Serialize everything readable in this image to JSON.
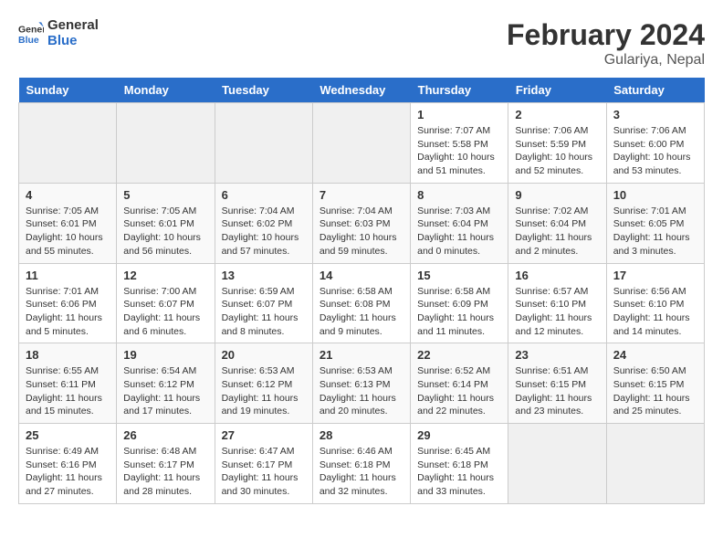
{
  "header": {
    "logo_line1": "General",
    "logo_line2": "Blue",
    "title": "February 2024",
    "subtitle": "Gulariya, Nepal"
  },
  "days_of_week": [
    "Sunday",
    "Monday",
    "Tuesday",
    "Wednesday",
    "Thursday",
    "Friday",
    "Saturday"
  ],
  "weeks": [
    [
      {
        "num": "",
        "info": ""
      },
      {
        "num": "",
        "info": ""
      },
      {
        "num": "",
        "info": ""
      },
      {
        "num": "",
        "info": ""
      },
      {
        "num": "1",
        "info": "Sunrise: 7:07 AM\nSunset: 5:58 PM\nDaylight: 10 hours and 51 minutes."
      },
      {
        "num": "2",
        "info": "Sunrise: 7:06 AM\nSunset: 5:59 PM\nDaylight: 10 hours and 52 minutes."
      },
      {
        "num": "3",
        "info": "Sunrise: 7:06 AM\nSunset: 6:00 PM\nDaylight: 10 hours and 53 minutes."
      }
    ],
    [
      {
        "num": "4",
        "info": "Sunrise: 7:05 AM\nSunset: 6:01 PM\nDaylight: 10 hours and 55 minutes."
      },
      {
        "num": "5",
        "info": "Sunrise: 7:05 AM\nSunset: 6:01 PM\nDaylight: 10 hours and 56 minutes."
      },
      {
        "num": "6",
        "info": "Sunrise: 7:04 AM\nSunset: 6:02 PM\nDaylight: 10 hours and 57 minutes."
      },
      {
        "num": "7",
        "info": "Sunrise: 7:04 AM\nSunset: 6:03 PM\nDaylight: 10 hours and 59 minutes."
      },
      {
        "num": "8",
        "info": "Sunrise: 7:03 AM\nSunset: 6:04 PM\nDaylight: 11 hours and 0 minutes."
      },
      {
        "num": "9",
        "info": "Sunrise: 7:02 AM\nSunset: 6:04 PM\nDaylight: 11 hours and 2 minutes."
      },
      {
        "num": "10",
        "info": "Sunrise: 7:01 AM\nSunset: 6:05 PM\nDaylight: 11 hours and 3 minutes."
      }
    ],
    [
      {
        "num": "11",
        "info": "Sunrise: 7:01 AM\nSunset: 6:06 PM\nDaylight: 11 hours and 5 minutes."
      },
      {
        "num": "12",
        "info": "Sunrise: 7:00 AM\nSunset: 6:07 PM\nDaylight: 11 hours and 6 minutes."
      },
      {
        "num": "13",
        "info": "Sunrise: 6:59 AM\nSunset: 6:07 PM\nDaylight: 11 hours and 8 minutes."
      },
      {
        "num": "14",
        "info": "Sunrise: 6:58 AM\nSunset: 6:08 PM\nDaylight: 11 hours and 9 minutes."
      },
      {
        "num": "15",
        "info": "Sunrise: 6:58 AM\nSunset: 6:09 PM\nDaylight: 11 hours and 11 minutes."
      },
      {
        "num": "16",
        "info": "Sunrise: 6:57 AM\nSunset: 6:10 PM\nDaylight: 11 hours and 12 minutes."
      },
      {
        "num": "17",
        "info": "Sunrise: 6:56 AM\nSunset: 6:10 PM\nDaylight: 11 hours and 14 minutes."
      }
    ],
    [
      {
        "num": "18",
        "info": "Sunrise: 6:55 AM\nSunset: 6:11 PM\nDaylight: 11 hours and 15 minutes."
      },
      {
        "num": "19",
        "info": "Sunrise: 6:54 AM\nSunset: 6:12 PM\nDaylight: 11 hours and 17 minutes."
      },
      {
        "num": "20",
        "info": "Sunrise: 6:53 AM\nSunset: 6:12 PM\nDaylight: 11 hours and 19 minutes."
      },
      {
        "num": "21",
        "info": "Sunrise: 6:53 AM\nSunset: 6:13 PM\nDaylight: 11 hours and 20 minutes."
      },
      {
        "num": "22",
        "info": "Sunrise: 6:52 AM\nSunset: 6:14 PM\nDaylight: 11 hours and 22 minutes."
      },
      {
        "num": "23",
        "info": "Sunrise: 6:51 AM\nSunset: 6:15 PM\nDaylight: 11 hours and 23 minutes."
      },
      {
        "num": "24",
        "info": "Sunrise: 6:50 AM\nSunset: 6:15 PM\nDaylight: 11 hours and 25 minutes."
      }
    ],
    [
      {
        "num": "25",
        "info": "Sunrise: 6:49 AM\nSunset: 6:16 PM\nDaylight: 11 hours and 27 minutes."
      },
      {
        "num": "26",
        "info": "Sunrise: 6:48 AM\nSunset: 6:17 PM\nDaylight: 11 hours and 28 minutes."
      },
      {
        "num": "27",
        "info": "Sunrise: 6:47 AM\nSunset: 6:17 PM\nDaylight: 11 hours and 30 minutes."
      },
      {
        "num": "28",
        "info": "Sunrise: 6:46 AM\nSunset: 6:18 PM\nDaylight: 11 hours and 32 minutes."
      },
      {
        "num": "29",
        "info": "Sunrise: 6:45 AM\nSunset: 6:18 PM\nDaylight: 11 hours and 33 minutes."
      },
      {
        "num": "",
        "info": ""
      },
      {
        "num": "",
        "info": ""
      }
    ]
  ]
}
